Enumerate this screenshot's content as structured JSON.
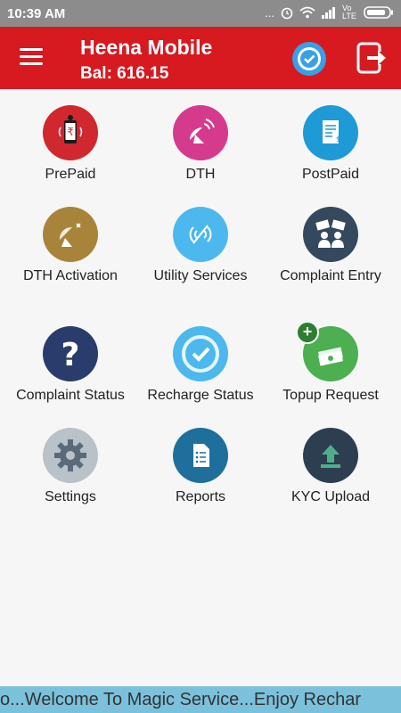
{
  "status_bar": {
    "time": "10:39 AM",
    "dots": "...",
    "network": "Vo LTE"
  },
  "header": {
    "title": "Heena Mobile",
    "balance": "Bal: 616.15"
  },
  "tiles": [
    {
      "label": "PrePaid",
      "icon": "prepaid-phone-icon",
      "color": "#d1272e"
    },
    {
      "label": "DTH",
      "icon": "dth-dish-icon",
      "color": "#d63a8d"
    },
    {
      "label": "PostPaid",
      "icon": "postpaid-bill-icon",
      "color": "#1e9ad6"
    },
    {
      "label": "DTH Activation",
      "icon": "satellite-dish-icon",
      "color": "#a8843a"
    },
    {
      "label": "Utility Services",
      "icon": "utility-signal-icon",
      "color": "#4cb8ee"
    },
    {
      "label": "Complaint Entry",
      "icon": "complaint-people-icon",
      "color": "#34495e"
    },
    {
      "label": "Complaint Status",
      "icon": "question-mark-icon",
      "color": "#2a3c6b"
    },
    {
      "label": "Recharge Status",
      "icon": "checkmark-icon",
      "color": "#4cb8ee"
    },
    {
      "label": "Topup Request",
      "icon": "money-stack-icon",
      "color": "#4caf50"
    },
    {
      "label": "Settings",
      "icon": "gear-icon",
      "color": "#b9c2c8"
    },
    {
      "label": "Reports",
      "icon": "report-document-icon",
      "color": "#1f6f9c"
    },
    {
      "label": "KYC Upload",
      "icon": "upload-arrow-icon",
      "color": "#2c3e50"
    }
  ],
  "ticker": {
    "text": "o...Welcome To Magic Service...Enjoy Rechar"
  },
  "colors": {
    "toolbar": "#d71920",
    "statusbar": "#8c8c8c",
    "ticker": "#7bc1dc"
  }
}
